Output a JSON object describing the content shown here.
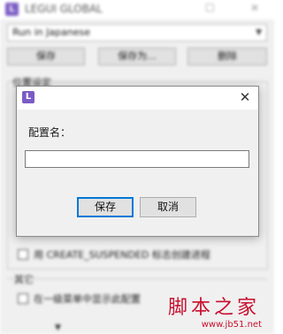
{
  "app": {
    "title": "LEGUI GLOBAL",
    "icon_letter": "L",
    "minimize": "—",
    "maximize": "☐",
    "close": "✕"
  },
  "profile": {
    "selected": "Run in Japanese",
    "dropdown_icon": "chevron-down-icon"
  },
  "toolbar": {
    "save": "保存",
    "save_as": "保存为...",
    "delete": "删除"
  },
  "location_group": "位置设定",
  "options": [
    {
      "label": "用 CREATE_SUSPENDED 标志创建进程",
      "checked": false
    },
    {
      "label": "在一级菜单中显示此配置",
      "checked": false
    }
  ],
  "other_group": "其它",
  "dialog": {
    "icon_letter": "L",
    "close": "✕",
    "label": "配置名：",
    "input_value": "",
    "ok": "保存",
    "cancel": "取消"
  },
  "watermark": {
    "text": "脚本之家",
    "url": "www.jb51.net"
  },
  "colors": {
    "accent": "#0078d7",
    "app_icon": "#7b5cc4",
    "watermark": "#c8102e"
  }
}
